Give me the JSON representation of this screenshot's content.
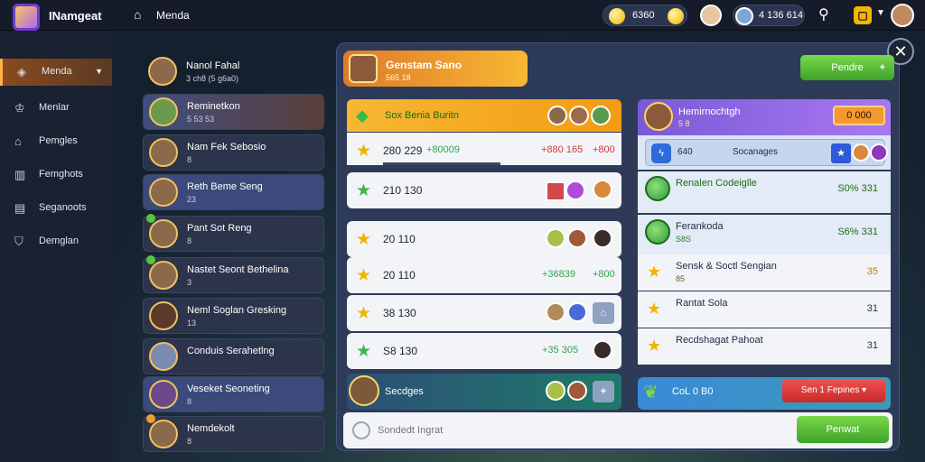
{
  "app": {
    "name": "INamgeat",
    "page_title": "Menda"
  },
  "topbar": {
    "coin_value": "6360",
    "gem_value": "4 136 614"
  },
  "nav": {
    "items": [
      {
        "label": "Menda",
        "icon": "gamepad-icon"
      },
      {
        "label": "Menlar",
        "icon": "crown-icon"
      },
      {
        "label": "Pemgles",
        "icon": "home-icon"
      },
      {
        "label": "Femghots",
        "icon": "building-icon"
      },
      {
        "label": "Seganoots",
        "icon": "document-icon"
      },
      {
        "label": "Demglan",
        "icon": "shield-icon"
      }
    ]
  },
  "friends": [
    {
      "name": "Nanol Fahal",
      "sub": "3 ch8 (5 g6a0)"
    },
    {
      "name": "Reminetkon",
      "sub": "5 53 53"
    },
    {
      "name": "Nam Fek Sebosio",
      "sub": "8"
    },
    {
      "name": "Reth Beme Seng",
      "sub": "23"
    },
    {
      "name": "Pant Sot Reng",
      "sub": "8"
    },
    {
      "name": "Nastet Seont Bethelina",
      "sub": "3"
    },
    {
      "name": "Neml Soglan Gresking",
      "sub": "13"
    },
    {
      "name": "Conduis Serahetlng",
      "sub": ""
    },
    {
      "name": "Veseket Seoneting",
      "sub": "8"
    },
    {
      "name": "Nemdekolt",
      "sub": "8"
    }
  ],
  "header": {
    "title": "Genstam Sano",
    "sub": "565 18"
  },
  "green_button": {
    "label": "Pendre",
    "symbol": "+"
  },
  "mid": {
    "head": {
      "title": "Sox Benia",
      "highlight": "Buritn"
    },
    "rows": [
      {
        "score": "280 229",
        "ex1": "+80009",
        "ex2": "+880 165",
        "ex3": "+800"
      },
      {
        "score": "210 130",
        "ex1": "",
        "ex2": "",
        "ex3": ""
      },
      {
        "score": "20 110",
        "ex1": "",
        "ex2": "",
        "ex3": ""
      },
      {
        "score": "20 110",
        "ex1": "+36839",
        "ex2": "",
        "ex3": "+800"
      },
      {
        "score": "38 130",
        "ex1": "",
        "ex2": "",
        "ex3": ""
      },
      {
        "score": "S8 130",
        "ex1": "+35 305",
        "ex2": "",
        "ex3": ""
      }
    ],
    "bottom": {
      "title": "Secdges"
    }
  },
  "right": {
    "head": {
      "name": "Hemirnochtgh",
      "sub": "5 8",
      "button": "0 000"
    },
    "sub": {
      "label": "640",
      "label2": "Socanages"
    },
    "rows": [
      {
        "title": "Renalen Codeiglle",
        "sub": "",
        "value": "S0% 331",
        "green": true
      },
      {
        "title": "Ferankoda",
        "sub": "S8S",
        "value": "S6% 331",
        "green": true
      },
      {
        "title": "Sensk & Soctl Sengian",
        "sub": "85",
        "value": "35",
        "green": false
      },
      {
        "title": "Rantat Sola",
        "sub": "",
        "value": "31",
        "green": false
      },
      {
        "title": "Recdshagat Pahoat",
        "sub": "",
        "value": "31",
        "green": false
      }
    ],
    "bottom": {
      "title": "CoL 0 B0",
      "button": "Sen 1 Fepines"
    }
  },
  "input": {
    "placeholder": "Sondedt Ingrat",
    "send": "Penwat"
  }
}
